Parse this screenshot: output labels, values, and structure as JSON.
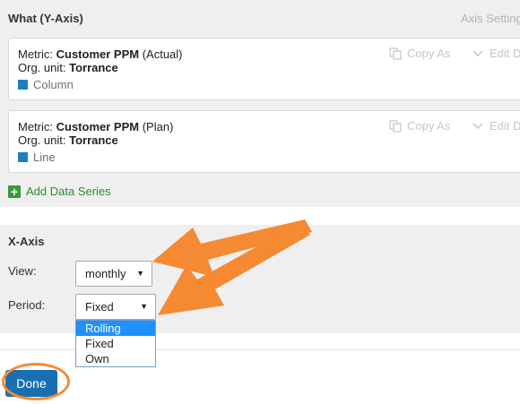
{
  "y_axis": {
    "title": "What (Y-Axis)",
    "axis_settings_label": "Axis Settings",
    "metric_label": "Metric:",
    "org_label": "Org. unit:",
    "series": [
      {
        "metric_name": "Customer PPM",
        "metric_qualifier": "(Actual)",
        "org_unit": "Torrance",
        "chart_type": "Column",
        "copy_label": "Copy As",
        "edit_label": "Edit D"
      },
      {
        "metric_name": "Customer PPM",
        "metric_qualifier": "(Plan)",
        "org_unit": "Torrance",
        "chart_type": "Line",
        "copy_label": "Copy As",
        "edit_label": "Edit D"
      }
    ],
    "add_series_label": "Add Data Series"
  },
  "x_axis": {
    "title": "X-Axis",
    "view_label": "View:",
    "view_value": "monthly",
    "period_label": "Period:",
    "period_value": "Fixed",
    "period_options": [
      "Rolling",
      "Fixed",
      "Own"
    ],
    "highlighted_option": "Rolling"
  },
  "footer": {
    "done_label": "Done"
  },
  "colors": {
    "series_swatch": "#1f7fbf",
    "annotation": "#f58a33",
    "done_button": "#1a6fb0",
    "add_series": "#3a9a3a"
  },
  "icons": {
    "copy": "copy-icon",
    "edit": "chevron-down-icon",
    "add": "plus-icon",
    "select_caret": "caret-down-icon"
  }
}
